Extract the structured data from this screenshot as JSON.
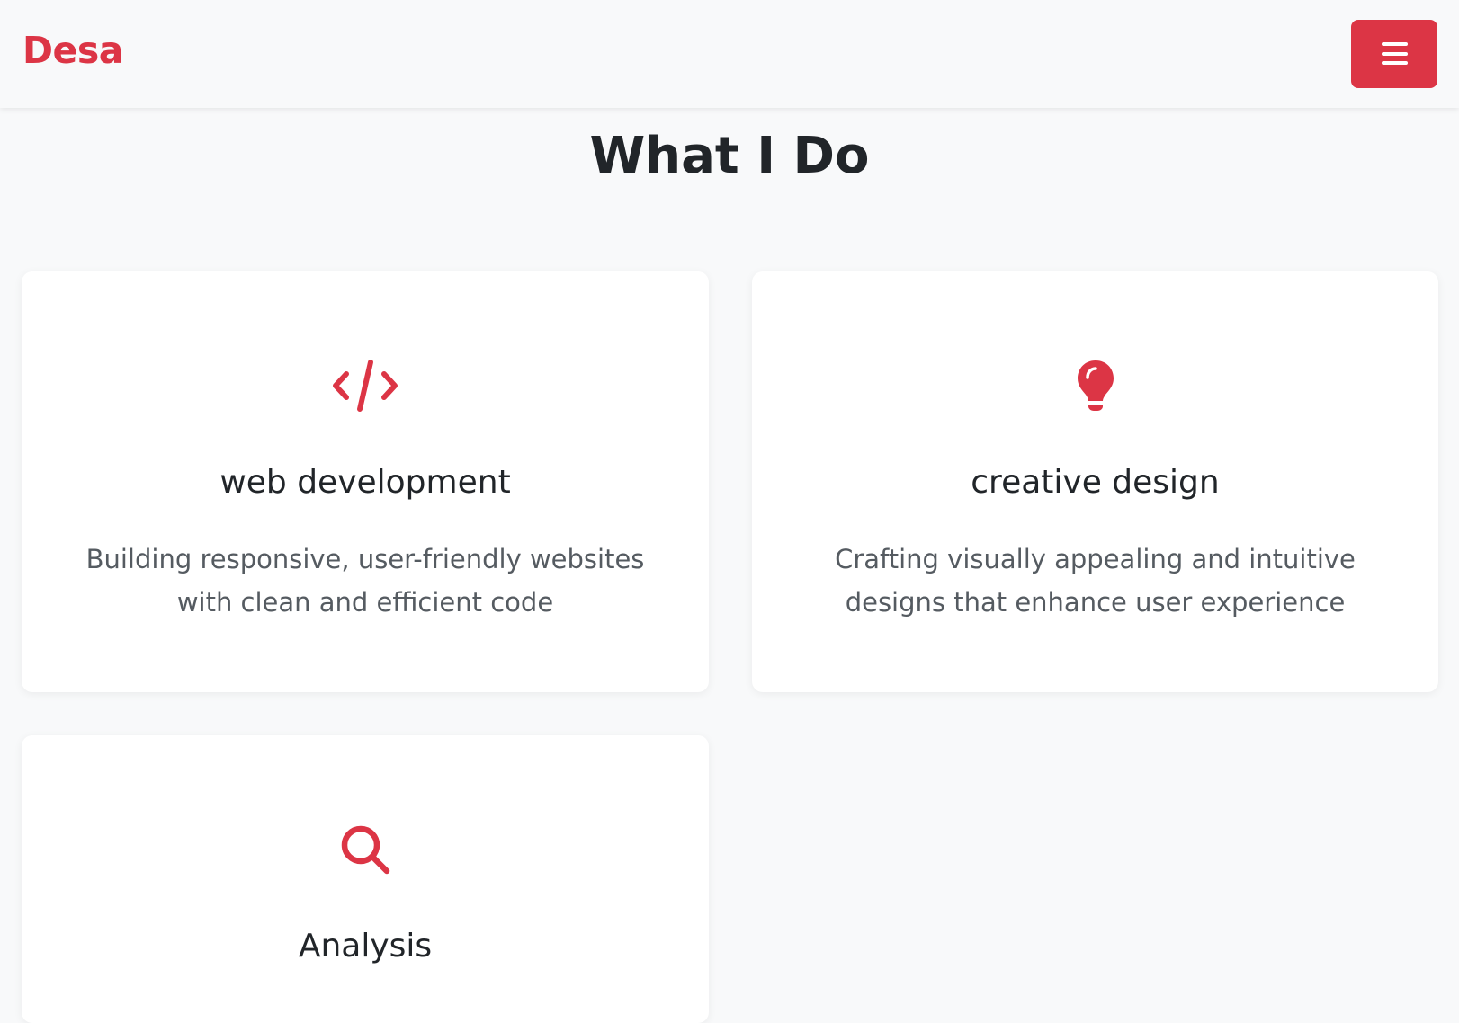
{
  "navbar": {
    "brand": "Desa",
    "toggle_icon": "hamburger-menu-icon"
  },
  "section": {
    "title": "What I Do"
  },
  "services": [
    {
      "icon": "code-icon",
      "title": "web development",
      "description": "Building responsive, user-friendly websites with clean and efficient code"
    },
    {
      "icon": "lightbulb-icon",
      "title": "creative design",
      "description": "Crafting visually appealing and intuitive designs that enhance user experience"
    },
    {
      "icon": "search-icon",
      "title": "Analysis",
      "description": ""
    }
  ],
  "colors": {
    "accent": "#dc3545",
    "page_background": "#f8f9fa",
    "card_background": "#ffffff",
    "heading_text": "#212529",
    "body_text": "#555b61"
  }
}
